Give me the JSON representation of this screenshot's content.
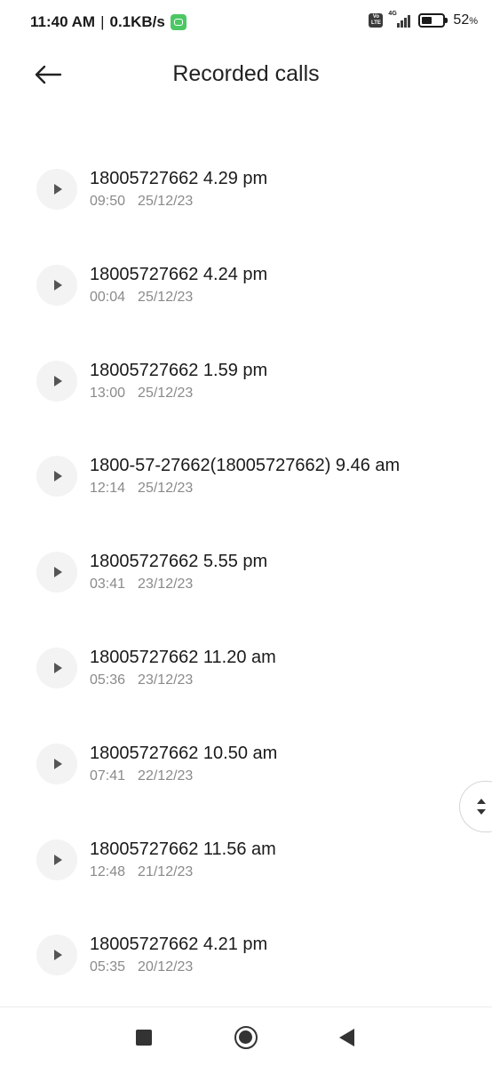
{
  "status_bar": {
    "time": "11:40 AM",
    "separator": "|",
    "network_speed": "0.1KB/s",
    "volte": "Vo LTE",
    "network_type": "4G",
    "battery_percent": "52",
    "battery_unit": "%",
    "battery_level": 0.52
  },
  "header": {
    "title": "Recorded calls",
    "back_icon": "arrow-left-icon"
  },
  "recordings": [
    {
      "title": "18005727662 4.29 pm",
      "duration": "09:50",
      "date": "25/12/23"
    },
    {
      "title": "18005727662 4.24 pm",
      "duration": "00:04",
      "date": "25/12/23"
    },
    {
      "title": "18005727662 1.59 pm",
      "duration": "13:00",
      "date": "25/12/23"
    },
    {
      "title": "1800-57-27662(18005727662) 9.46 am",
      "duration": "12:14",
      "date": "25/12/23"
    },
    {
      "title": "18005727662 5.55 pm",
      "duration": "03:41",
      "date": "23/12/23"
    },
    {
      "title": "18005727662 11.20 am",
      "duration": "05:36",
      "date": "23/12/23"
    },
    {
      "title": "18005727662 10.50 am",
      "duration": "07:41",
      "date": "22/12/23"
    },
    {
      "title": "18005727662 11.56 am",
      "duration": "12:48",
      "date": "21/12/23"
    },
    {
      "title": "18005727662 4.21 pm",
      "duration": "05:35",
      "date": "20/12/23"
    }
  ],
  "icons": {
    "play": "play-icon",
    "scroll": "scroll-up-down-icon",
    "nav_recents": "square-icon",
    "nav_home": "circle-icon",
    "nav_back": "triangle-back-icon"
  }
}
